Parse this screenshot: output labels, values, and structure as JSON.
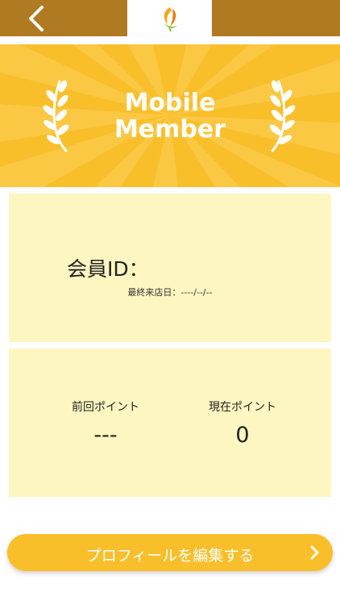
{
  "header": {
    "back_icon": "chevron-left-icon",
    "logo_icon": "app-logo-icon",
    "bar_color": "#b07a22"
  },
  "hero": {
    "title_line1": "Mobile",
    "title_line2": "Member",
    "background_color": "#f9bf2b"
  },
  "member": {
    "id_label": "会員ID：",
    "last_visit": "最終来店日：----/--/--"
  },
  "points": {
    "previous_label": "前回ポイント",
    "previous_value": "---",
    "current_label": "現在ポイント",
    "current_value": "0"
  },
  "footer": {
    "edit_profile_label": "プロフィールを編集する",
    "chevron_icon": "chevron-right-icon"
  }
}
